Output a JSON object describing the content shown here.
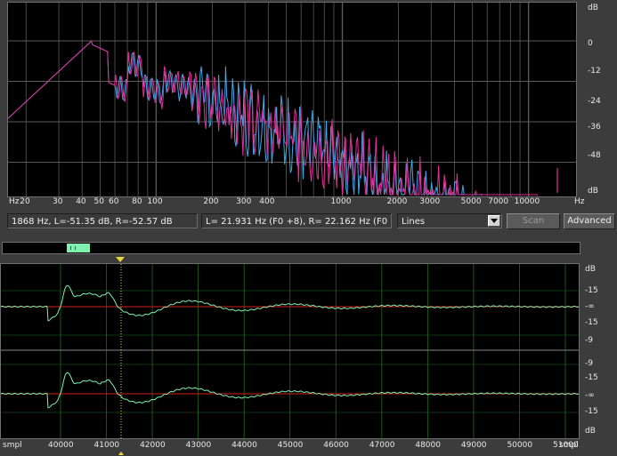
{
  "spectrum": {
    "x_unit_left": "Hz",
    "x_unit_right": "Hz",
    "y_ticks": [
      "dB",
      "0",
      "-12",
      "-24",
      "-36",
      "-48",
      "dB"
    ],
    "x_ticks": [
      "20",
      "30",
      "40",
      "50",
      "60",
      "80",
      "100",
      "200",
      "300",
      "400",
      "1000",
      "2000",
      "3000",
      "5000",
      "7000",
      "10000"
    ],
    "colors": {
      "left": "#e0309a",
      "right": "#3fa7e8",
      "grid": "#5a5a5a"
    }
  },
  "status": {
    "cursor_readout": "1868 Hz, L=-51.35 dB, R=-52.57 dB",
    "peak_readout": "L= 21.931 Hz (F0 +8), R= 22.162 Hz (F0",
    "mode_value": "Lines",
    "scan_label": "Scan",
    "advanced_label": "Advanced"
  },
  "waveform": {
    "top_ticks": [
      "dB",
      "-15",
      "-∞",
      "-15",
      "-9"
    ],
    "bottom_ticks": [
      "-9",
      "-15",
      "-∞",
      "-15",
      "dB"
    ],
    "x_unit_left": "smpl",
    "x_unit_right": "smpl",
    "x_ticks": [
      "40000",
      "41000",
      "42000",
      "43000",
      "44000",
      "45000",
      "46000",
      "47000",
      "48000",
      "49000",
      "50000",
      "51000"
    ],
    "colors": {
      "wave": "#7ff0b0",
      "zero_line": "#d02020",
      "grid": "#1f6b1f",
      "cursor": "#e8d83a"
    }
  }
}
